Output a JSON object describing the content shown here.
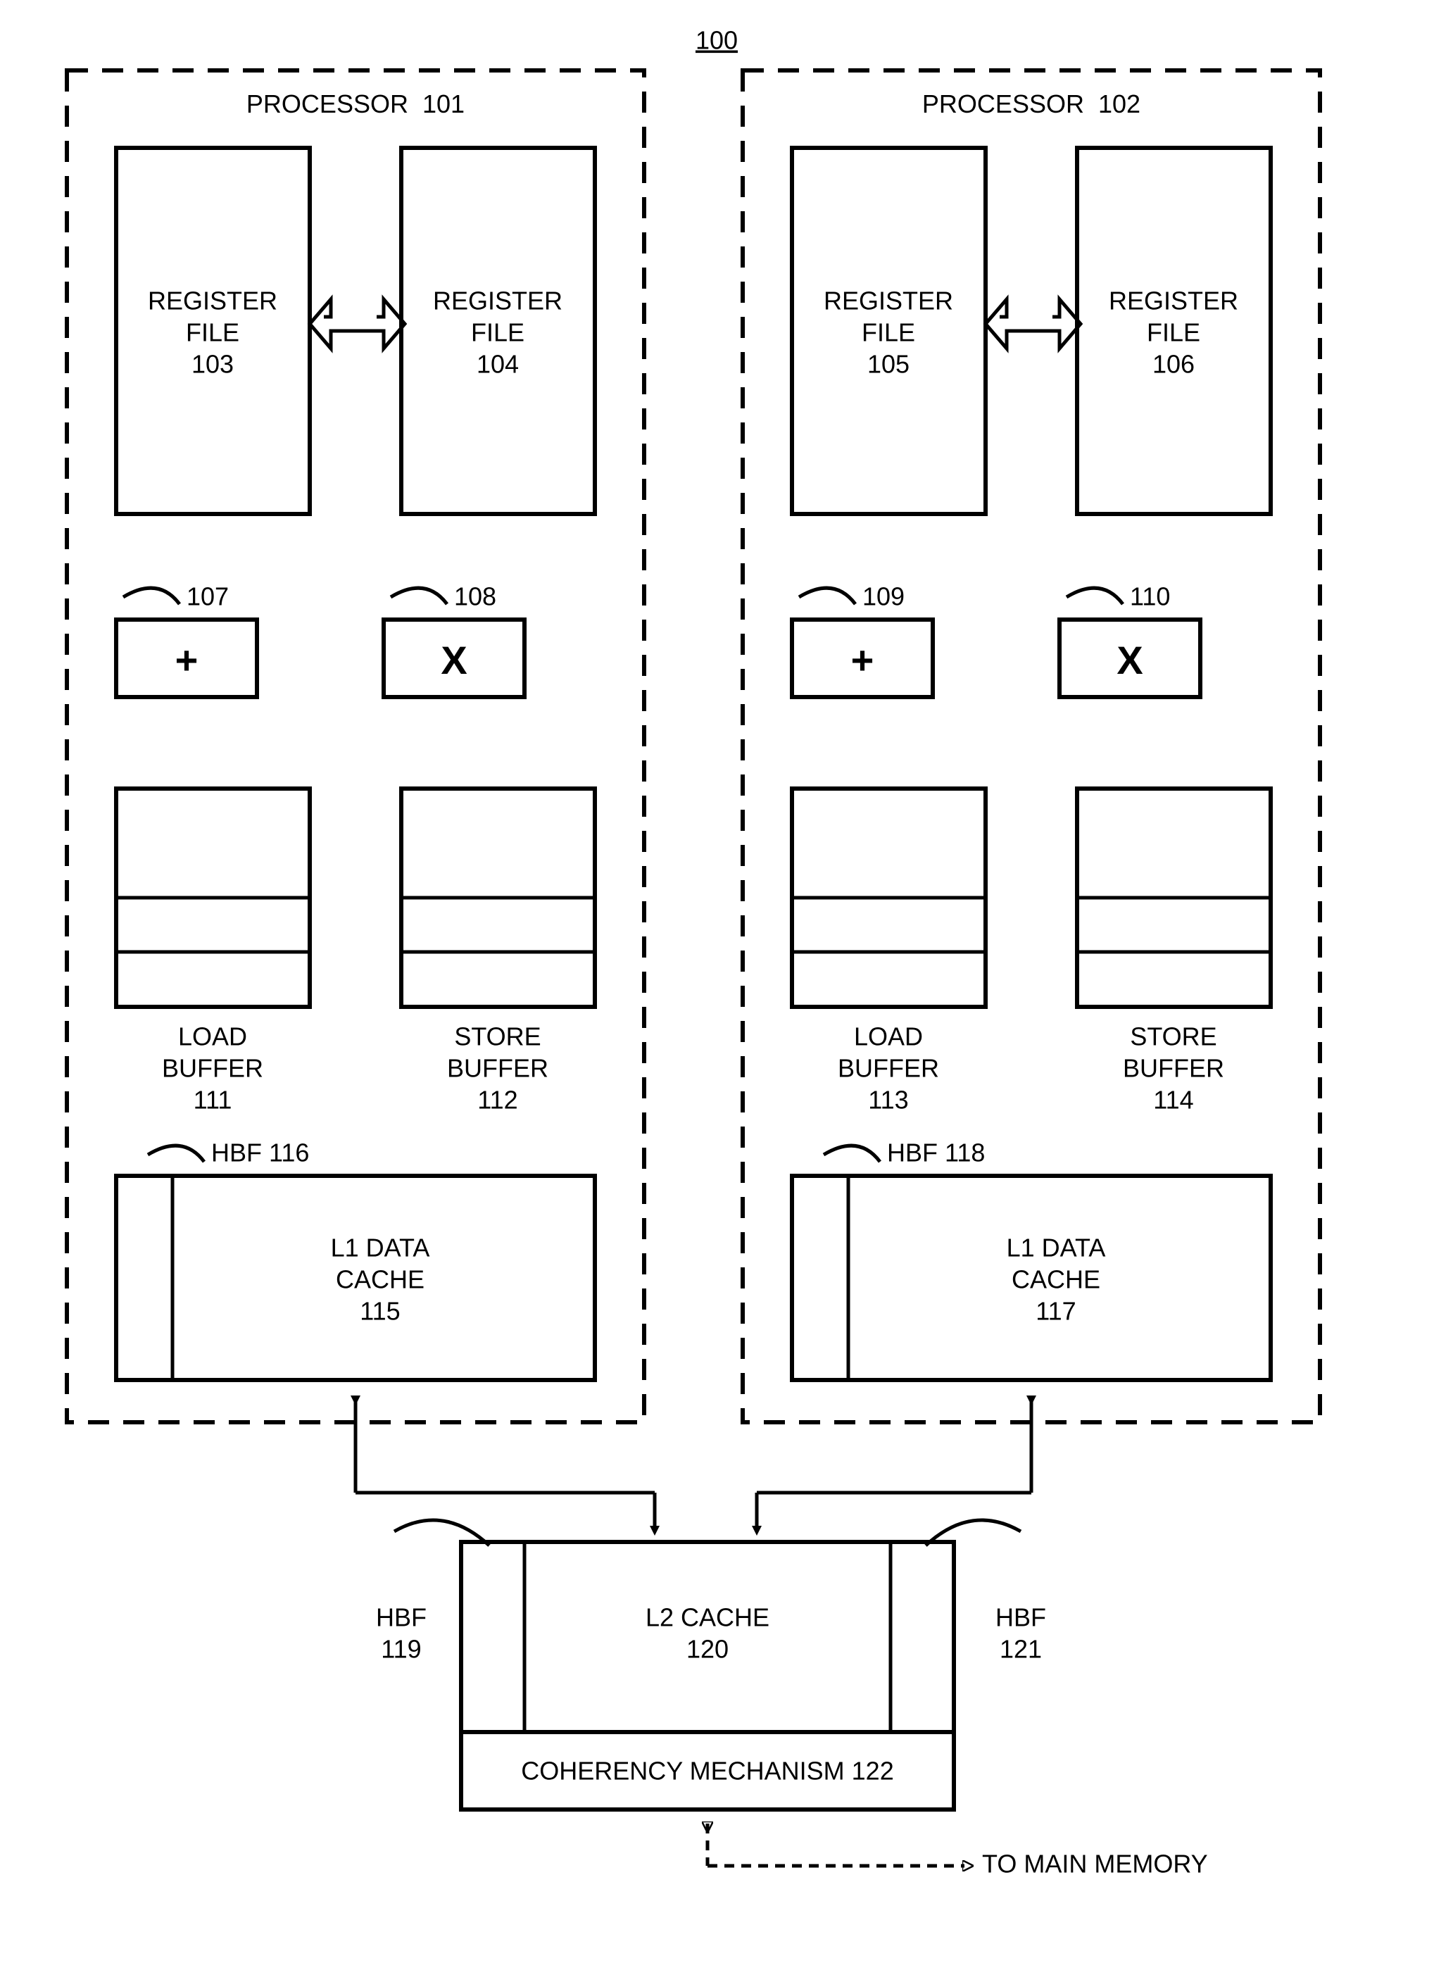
{
  "figureNumber": "100",
  "processors": [
    {
      "title_prefix": "PROCESSOR",
      "title_num": "101",
      "regfiles": [
        {
          "label1": "REGISTER",
          "label2": "FILE",
          "num": "103"
        },
        {
          "label1": "REGISTER",
          "label2": "FILE",
          "num": "104"
        }
      ],
      "ops": [
        {
          "tag": "107",
          "glyph": "+"
        },
        {
          "tag": "108",
          "glyph": "X"
        }
      ],
      "buffers": [
        {
          "label1": "LOAD",
          "label2": "BUFFER",
          "num": "111"
        },
        {
          "label1": "STORE",
          "label2": "BUFFER",
          "num": "112"
        }
      ],
      "l1": {
        "hbf_label": "HBF 116",
        "label1": "L1 DATA",
        "label2": "CACHE",
        "num": "115"
      }
    },
    {
      "title_prefix": "PROCESSOR",
      "title_num": "102",
      "regfiles": [
        {
          "label1": "REGISTER",
          "label2": "FILE",
          "num": "105"
        },
        {
          "label1": "REGISTER",
          "label2": "FILE",
          "num": "106"
        }
      ],
      "ops": [
        {
          "tag": "109",
          "glyph": "+"
        },
        {
          "tag": "110",
          "glyph": "X"
        }
      ],
      "buffers": [
        {
          "label1": "LOAD",
          "label2": "BUFFER",
          "num": "113"
        },
        {
          "label1": "STORE",
          "label2": "BUFFER",
          "num": "114"
        }
      ],
      "l1": {
        "hbf_label": "HBF 118",
        "label1": "L1 DATA",
        "label2": "CACHE",
        "num": "117"
      }
    }
  ],
  "l2": {
    "label": "L2 CACHE",
    "num": "120",
    "hbf_left": "HBF",
    "hbf_left_num": "119",
    "hbf_right": "HBF",
    "hbf_right_num": "121"
  },
  "coherency": "COHERENCY MECHANISM 122",
  "memory_text": "TO MAIN MEMORY"
}
